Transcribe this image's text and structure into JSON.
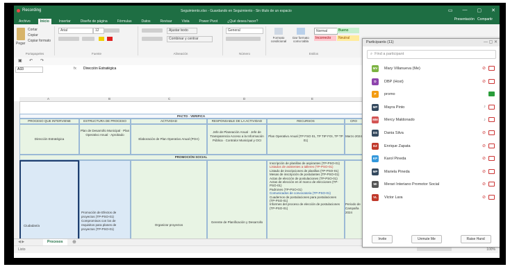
{
  "recording": {
    "label": "Recording"
  },
  "window": {
    "title": "Seguimiento.xlsx - Guardando en Seguimiento - Sin título de un espacio",
    "controls": [
      "▭",
      "—",
      "▢",
      "✕"
    ]
  },
  "ribbon_tabs": [
    "Archivo",
    "Inicio",
    "Insertar",
    "Diseño de página",
    "Fórmulas",
    "Datos",
    "Revisar",
    "Vista",
    "Power Pivot",
    "¿Qué desea hacer?"
  ],
  "share": {
    "presentation": "Presentación",
    "share": "Compartir"
  },
  "ribbon": {
    "clipboard": {
      "cut": "Cortar",
      "copy": "Copiar",
      "format_painter": "Copiar formato",
      "paste": "Pegar",
      "label": "Portapapeles"
    },
    "font": {
      "name": "Arial",
      "size": "12",
      "label": "Fuente"
    },
    "alignment": {
      "wrap": "Ajustar texto",
      "merge": "Combinar y centrar",
      "label": "Alineación"
    },
    "number": {
      "format": "General",
      "label": "Número"
    },
    "styles": {
      "conditional": "Formato condicional",
      "table": "Dar formato como tabla",
      "normal": "Normal",
      "bueno": "Bueno",
      "incorrecto": "Incorrecto",
      "neutral": "Neutral",
      "label": "Estilos"
    }
  },
  "formula_bar": {
    "cell": "A33",
    "fx": "fx",
    "value": "Dirección Estratégica"
  },
  "columns": [
    "A",
    "B",
    "C",
    "D",
    "E",
    "F"
  ],
  "sheet": {
    "header_top": "PACTO · VERIFICA",
    "headers": [
      "PROCESO QUE INTERVIENE",
      "ESTRUCTURA DE PROCESO",
      "ACTIVIDAD",
      "RESPONSABLE DE LA ACTIVIDAD",
      "RECURSOS",
      "CRO"
    ],
    "row1": {
      "proceso": "Dirección Estratégica",
      "estructura": "Plan de Desarrollo Municipal · Plan Operativo Anual · Aprobado",
      "actividad": "Elaboración de Plan Operativo Anual (POA)",
      "responsable": "Jefe de Planeación Anual · Jefe de Transparencia Acceso a la Información Pública · Contralor Municipal y OCI",
      "recursos": "Plan Operativo Anual (TP FSO 01, TP TIP FOI, TP TP 01)",
      "cro": "Marzo 2024"
    },
    "section": "PROMOCIÓN SOCIAL",
    "row2": {
      "proceso": "Ciudadanía",
      "estructura": "Promoción de Efectos de proyectos (TP-PSO-01) Compromisos con los de requisitos para planes de proyectos (TP-PSO-01)",
      "actividad": "Organizar proyectos",
      "responsable": "Gerente de Planificación y Desarrollo",
      "recursos_lines": [
        "Inscripción de planillas de aspirantes (TP-PSO-01)",
        "Listados de asistentes a talleres (TP-PSO-01)",
        "Listado de inscripciones de planillas (TP-PSO-01)",
        "Mesas de inscripción de postulantes (TP-PSO-01)",
        "Actas de elección de postulaciones (TP-PSO-01)",
        "Actas de elección en el marco de elecciones (TP-PSO-01)",
        "Padrones (TP-PSO-01)",
        "Comunicados de convocatoria (TP-PSO-01)",
        "Cuadernos de postulaciones para postulaciones (TP-PSO-01)",
        "Informes del proceso de elección de postulaciones (TP-PSO-01)"
      ],
      "cro": "Periodo de Campaña 2024"
    }
  },
  "sheet_tabs": [
    "Procesos"
  ],
  "status": {
    "ready": "Listo",
    "zoom": "100%"
  },
  "participants": {
    "title": "Participants (11)",
    "search_placeholder": "Find a participant",
    "list": [
      {
        "initials": "MV",
        "name": "Mary Villanueva (Me)",
        "color": "#7cb342",
        "mic": "muted",
        "cam": "off"
      },
      {
        "initials": "D",
        "name": "DBP (Host)",
        "color": "#8e44ad",
        "mic": "muted",
        "cam": "off"
      },
      {
        "initials": "P",
        "name": "promo",
        "color": "#f39c12",
        "mic": "none",
        "cam": "on"
      },
      {
        "initials": "MP",
        "name": "Mayra Pinto",
        "color": "#34495e",
        "mic": "on",
        "cam": "off"
      },
      {
        "initials": "MM",
        "name": "Mercy Maldonado",
        "color": "#d35454",
        "mic": "on",
        "cam": "off"
      },
      {
        "initials": "DS",
        "name": "Dania Silva",
        "color": "#34495e",
        "mic": "muted",
        "cam": "off"
      },
      {
        "initials": "EZ",
        "name": "Enrique Zapata",
        "color": "#c0392b",
        "mic": "muted",
        "cam": "off"
      },
      {
        "initials": "KP",
        "name": "Karol Pineda",
        "color": "#3498db",
        "mic": "muted",
        "cam": "off"
      },
      {
        "initials": "MP",
        "name": "Mariela Pineda",
        "color": "#34495e",
        "mic": "muted",
        "cam": "off"
      },
      {
        "initials": "MI",
        "name": "Merari Interiano Promotor Social",
        "color": "#555555",
        "mic": "muted",
        "cam": "off"
      },
      {
        "initials": "VL",
        "name": "Victor Lara",
        "color": "#c0392b",
        "mic": "muted",
        "cam": "off"
      }
    ],
    "buttons": {
      "invite": "Invite",
      "unmute": "Unmute Me",
      "raise": "Raise Hand"
    }
  }
}
